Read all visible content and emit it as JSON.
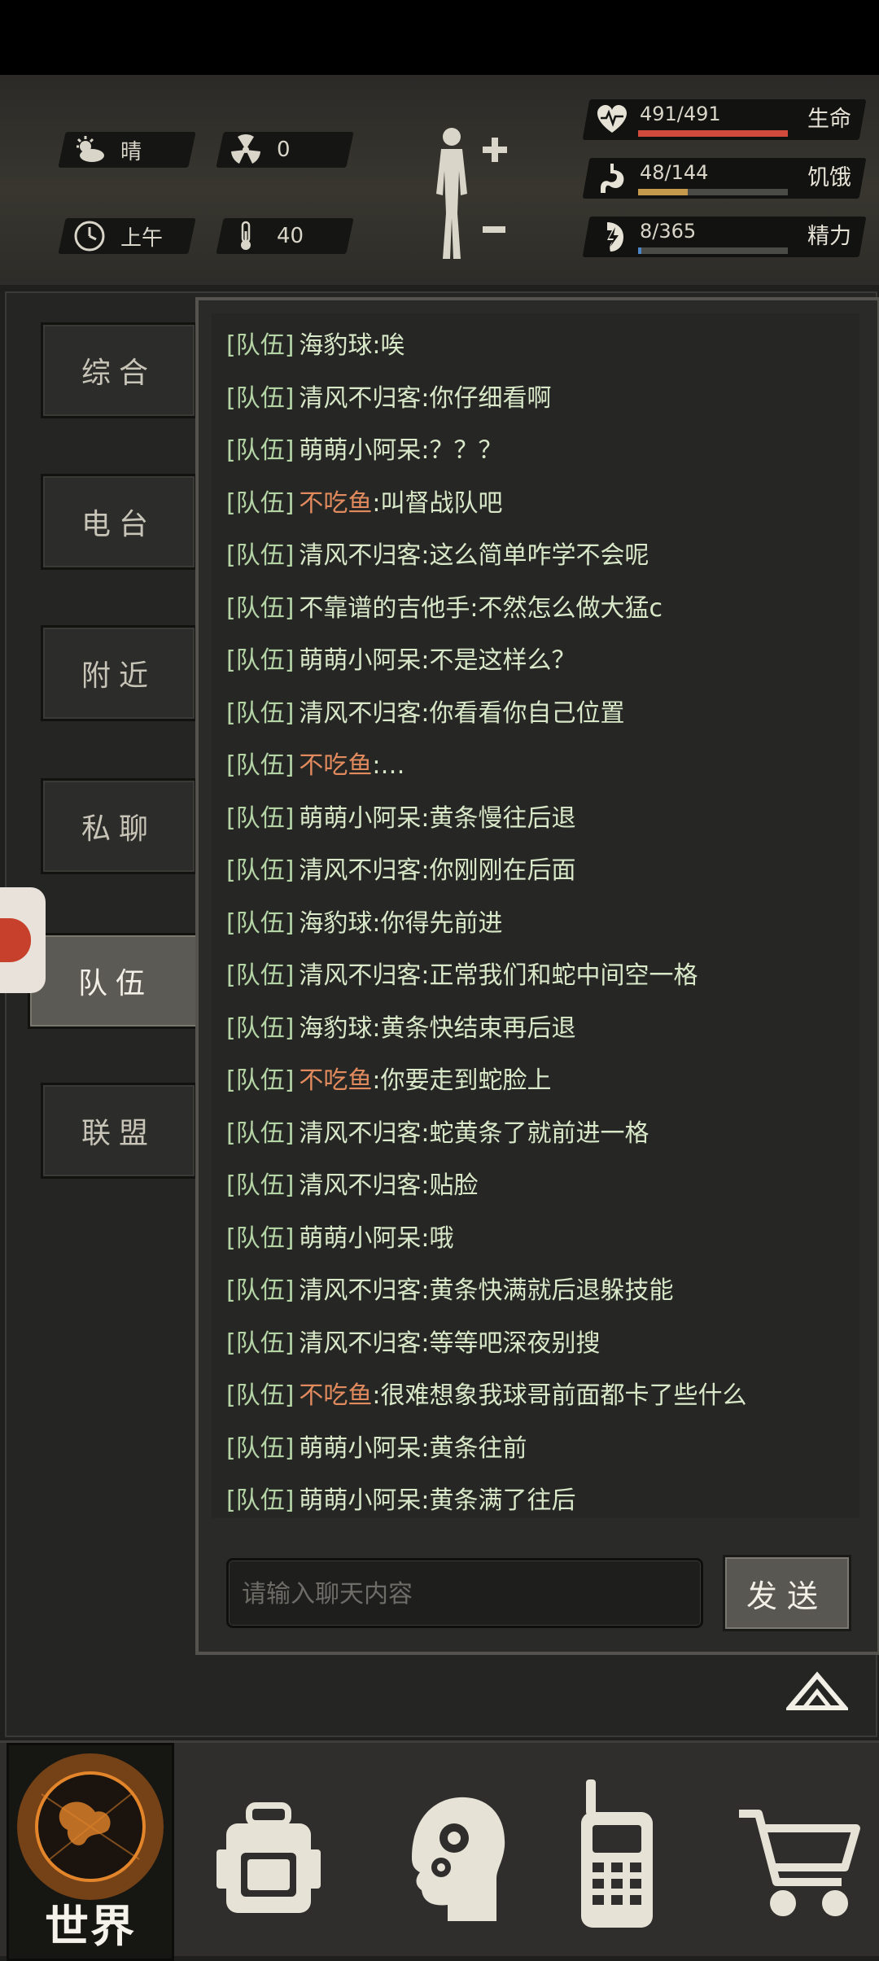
{
  "hud": {
    "weather": "晴",
    "radiation": "0",
    "time_of_day": "上午",
    "temperature": "40"
  },
  "stats": [
    {
      "name": "生命",
      "value": "491/491",
      "fraction": 1.0,
      "color": "#d24a3c",
      "icon": "heart-pulse-icon"
    },
    {
      "name": "饥饿",
      "value": "48/144",
      "fraction": 0.333,
      "color": "#c69a4c",
      "icon": "stomach-icon"
    },
    {
      "name": "精力",
      "value": "8/365",
      "fraction": 0.022,
      "color": "#4a86c8",
      "icon": "energy-bolt-icon"
    }
  ],
  "tabs": [
    {
      "label": "综合",
      "active": false
    },
    {
      "label": "电台",
      "active": false
    },
    {
      "label": "附近",
      "active": false
    },
    {
      "label": "私聊",
      "active": false
    },
    {
      "label": "队伍",
      "active": true
    },
    {
      "label": "联盟",
      "active": false
    }
  ],
  "chat": {
    "messages": [
      {
        "channel": "[队伍]",
        "sender": "海豹球",
        "text": ":唉",
        "highlight": false
      },
      {
        "channel": "[队伍]",
        "sender": "清风不归客",
        "text": ":你仔细看啊",
        "highlight": false
      },
      {
        "channel": "[队伍]",
        "sender": "萌萌小阿呆",
        "text": ":？？？",
        "highlight": false
      },
      {
        "channel": "[队伍]",
        "sender": "不吃鱼",
        "text": ":叫督战队吧",
        "highlight": true
      },
      {
        "channel": "[队伍]",
        "sender": "清风不归客",
        "text": ":这么简单咋学不会呢",
        "highlight": false
      },
      {
        "channel": "[队伍]",
        "sender": "不靠谱的吉他手",
        "text": ":不然怎么做大猛c",
        "highlight": false
      },
      {
        "channel": "[队伍]",
        "sender": "萌萌小阿呆",
        "text": ":不是这样么？",
        "highlight": false
      },
      {
        "channel": "[队伍]",
        "sender": "清风不归客",
        "text": ":你看看你自己位置",
        "highlight": false
      },
      {
        "channel": "[队伍]",
        "sender": "不吃鱼",
        "text": ":…",
        "highlight": true
      },
      {
        "channel": "[队伍]",
        "sender": "萌萌小阿呆",
        "text": ":黄条慢往后退",
        "highlight": false
      },
      {
        "channel": "[队伍]",
        "sender": "清风不归客",
        "text": ":你刚刚在后面",
        "highlight": false
      },
      {
        "channel": "[队伍]",
        "sender": "海豹球",
        "text": ":你得先前进",
        "highlight": false
      },
      {
        "channel": "[队伍]",
        "sender": "清风不归客",
        "text": ":正常我们和蛇中间空一格",
        "highlight": false
      },
      {
        "channel": "[队伍]",
        "sender": "海豹球",
        "text": ":黄条快结束再后退",
        "highlight": false
      },
      {
        "channel": "[队伍]",
        "sender": "不吃鱼",
        "text": ":你要走到蛇脸上",
        "highlight": true
      },
      {
        "channel": "[队伍]",
        "sender": "清风不归客",
        "text": ":蛇黄条了就前进一格",
        "highlight": false
      },
      {
        "channel": "[队伍]",
        "sender": "清风不归客",
        "text": ":贴脸",
        "highlight": false
      },
      {
        "channel": "[队伍]",
        "sender": "萌萌小阿呆",
        "text": ":哦",
        "highlight": false
      },
      {
        "channel": "[队伍]",
        "sender": "清风不归客",
        "text": ":黄条快满就后退躲技能",
        "highlight": false
      },
      {
        "channel": "[队伍]",
        "sender": "清风不归客",
        "text": ":等等吧深夜别搜",
        "highlight": false
      },
      {
        "channel": "[队伍]",
        "sender": "不吃鱼",
        "text": ":很难想象我球哥前面都卡了些什么",
        "highlight": true
      },
      {
        "channel": "[队伍]",
        "sender": "萌萌小阿呆",
        "text": ":黄条往前",
        "highlight": false
      },
      {
        "channel": "[队伍]",
        "sender": "萌萌小阿呆",
        "text": ":黄条满了往后",
        "highlight": false
      }
    ],
    "input_placeholder": "请输入聊天内容",
    "send_label": "发送"
  },
  "bottom_nav": {
    "world_label": "世界",
    "items": [
      "globe-icon",
      "backpack-icon",
      "head-gears-icon",
      "walkie-talkie-icon",
      "shopping-cart-icon"
    ]
  }
}
